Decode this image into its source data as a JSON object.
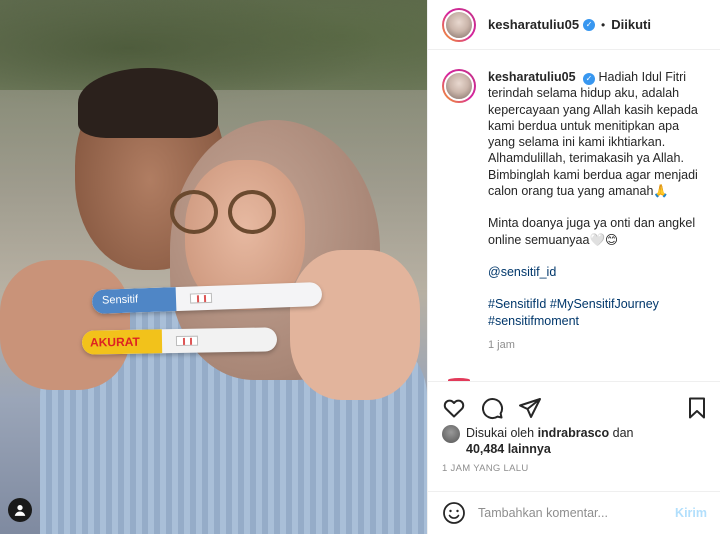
{
  "post": {
    "username": "kesharatuliu05",
    "follow_status": "Diikuti",
    "dot": "•",
    "caption_paragraphs": [
      "Hadiah Idul Fitri terindah selama hidup aku, adalah kepercayaan yang Allah kasih kepada kami berdua untuk menitipkan apa yang selama ini kami ikhtiarkan. Alhamdulillah, terimakasih ya Allah. Bimbinglah kami berdua agar menjadi calon orang tua yang amanah🙏",
      "Minta doanya juga ya onti dan angkel online semuanyaa🤍😊"
    ],
    "mention": "@sensitif_id",
    "hashtags_line1": "#SensitifId #MySensitifJourney",
    "hashtags_line2": "#sensitifmoment",
    "caption_time": "1 jam",
    "liked_by_prefix": "Disukai oleh",
    "liked_by_user": "indrabrasco",
    "liked_by_and": "dan",
    "liked_by_count": "40,484 lainnya",
    "timestamp": "1 JAM YANG LALU",
    "comment_placeholder": "Tambahkan komentar...",
    "post_button": "Kirim"
  },
  "photo": {
    "test1_brand": "Sensitif",
    "test2_brand": "AKURAT"
  },
  "colors": {
    "verified": "#3897f0",
    "link": "#00376b",
    "post_button_disabled": "#b2dffc",
    "secondary_text": "#8e8e8e"
  },
  "icons": [
    "heart-icon",
    "comment-icon",
    "share-icon",
    "bookmark-icon",
    "emoji-icon",
    "verified-icon",
    "user-tag-icon"
  ]
}
